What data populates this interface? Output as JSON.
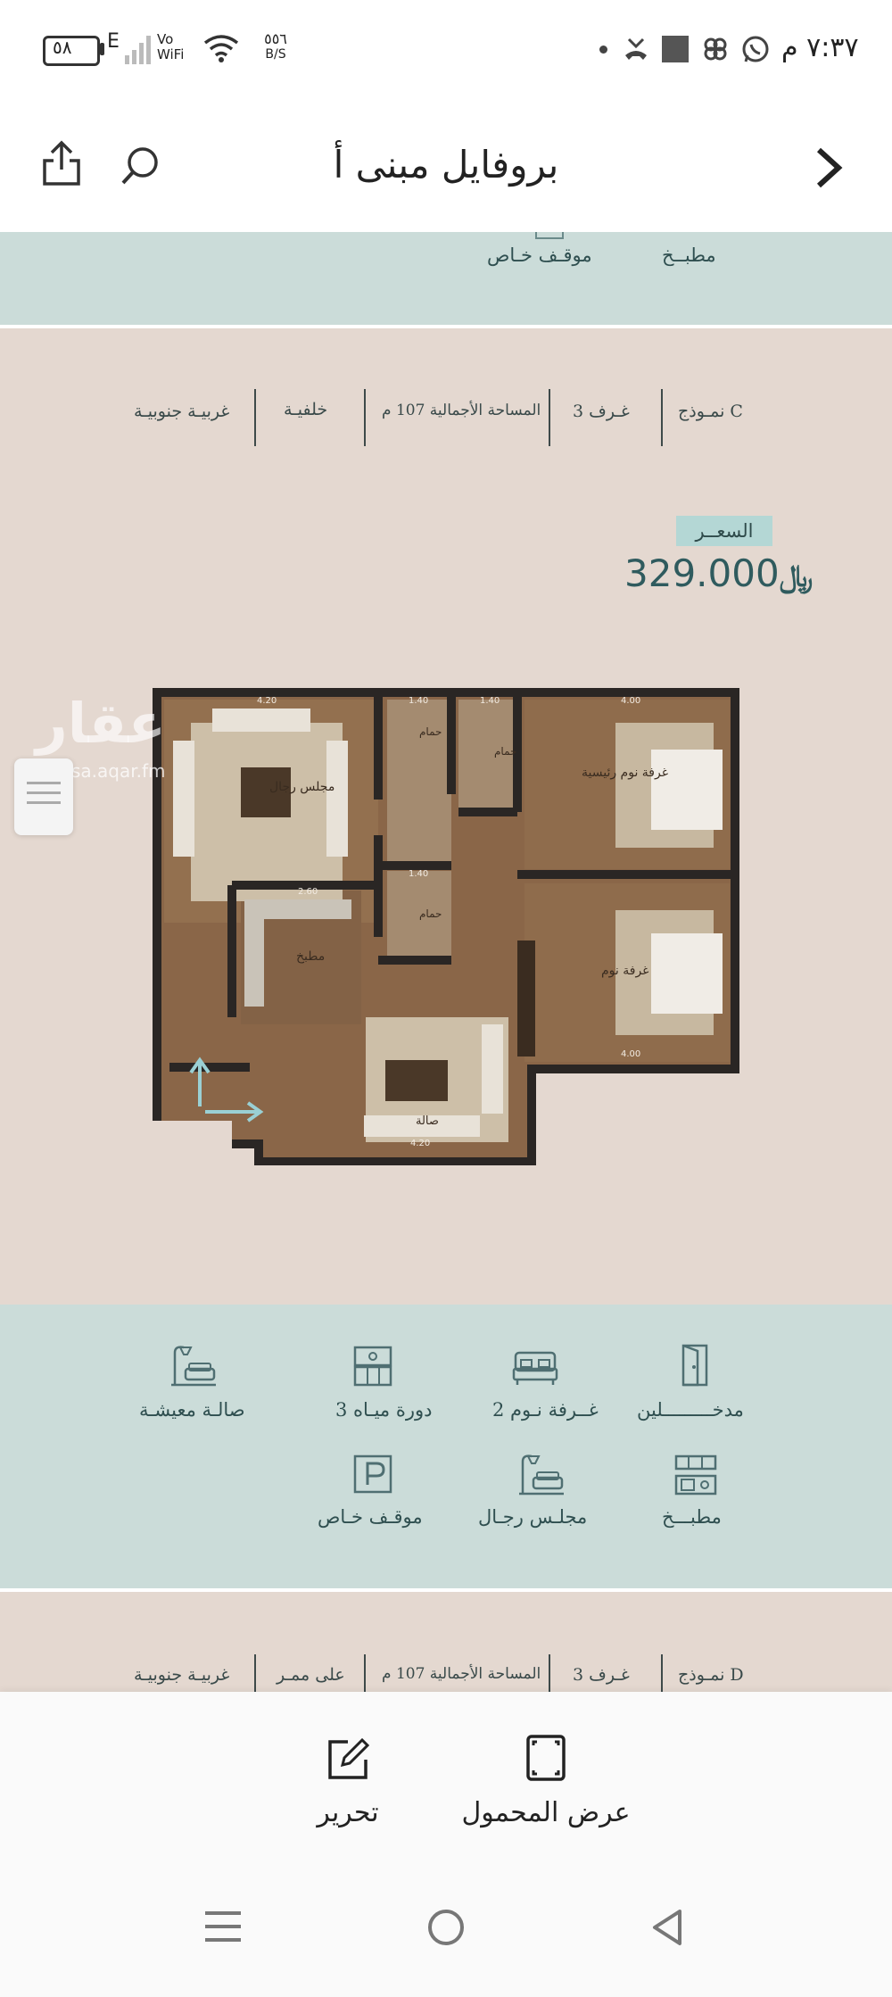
{
  "status_bar": {
    "time": "٧:٣٧ م",
    "battery": "٥٨",
    "network": "E",
    "vowifi": "Vo\nWiFi",
    "speed_value": "٥٥٦",
    "speed_unit": "B/S"
  },
  "header": {
    "title": "بروفايل مبنى أ"
  },
  "top_band": {
    "items": [
      "مطبــخ",
      "موقـف خـاص"
    ]
  },
  "model_c": {
    "specs": [
      "نمـوذج C",
      "3 غـرف",
      "المساحة الأجمالية 107 م",
      "خلفيـة",
      "غربيـة جنوبيـة"
    ],
    "price_label": "السعــر",
    "price": "329.000",
    "currency": "﷼",
    "watermark": "عقار",
    "watermark_sub": "sa.aqar.fm",
    "rooms": {
      "living": "مجلس رجال",
      "master": "غرفة نوم رئيسية",
      "bedroom": "غرفة نوم",
      "kitchen": "مطبخ",
      "bath1": "حمام",
      "bath2": "حمام",
      "bath3": "حمام",
      "hall": "صالة",
      "dim_420_top": "4.20",
      "dim_140_a": "1.40",
      "dim_140_b": "1.40",
      "dim_400_top": "4.00",
      "dim_260": "2.60",
      "dim_140_c": "1.40",
      "dim_400_bottom": "4.00",
      "dim_420_bottom": "4.20"
    }
  },
  "features": {
    "row1": [
      {
        "label": "مدخـــــــــلين",
        "icon": "door-icon"
      },
      {
        "label": "2 غــرفة نـوم",
        "icon": "bed-icon"
      },
      {
        "label": "3 دورة ميـاه",
        "icon": "bathroom-icon"
      },
      {
        "label": "صالـة معيشـة",
        "icon": "sofa-lamp-icon"
      }
    ],
    "row2": [
      {
        "label": "مطبـــخ",
        "icon": "kitchen-icon"
      },
      {
        "label": "مجلـس رجـال",
        "icon": "sofa-lamp-icon"
      },
      {
        "label": "موقـف خـاص",
        "icon": "parking-icon"
      }
    ]
  },
  "model_d": {
    "specs": [
      "نمـوذج D",
      "3 غـرف",
      "المساحة الأجمالية 107 م",
      "على ممـر",
      "غربيـة جنوبيـة"
    ]
  },
  "actions": {
    "fit_label": "عرض المحمول",
    "edit_label": "تحرير"
  },
  "colors": {
    "teal_band": "#cbdcd9",
    "beige_band": "#e4d8d0",
    "price_color": "#2f5b5e"
  }
}
